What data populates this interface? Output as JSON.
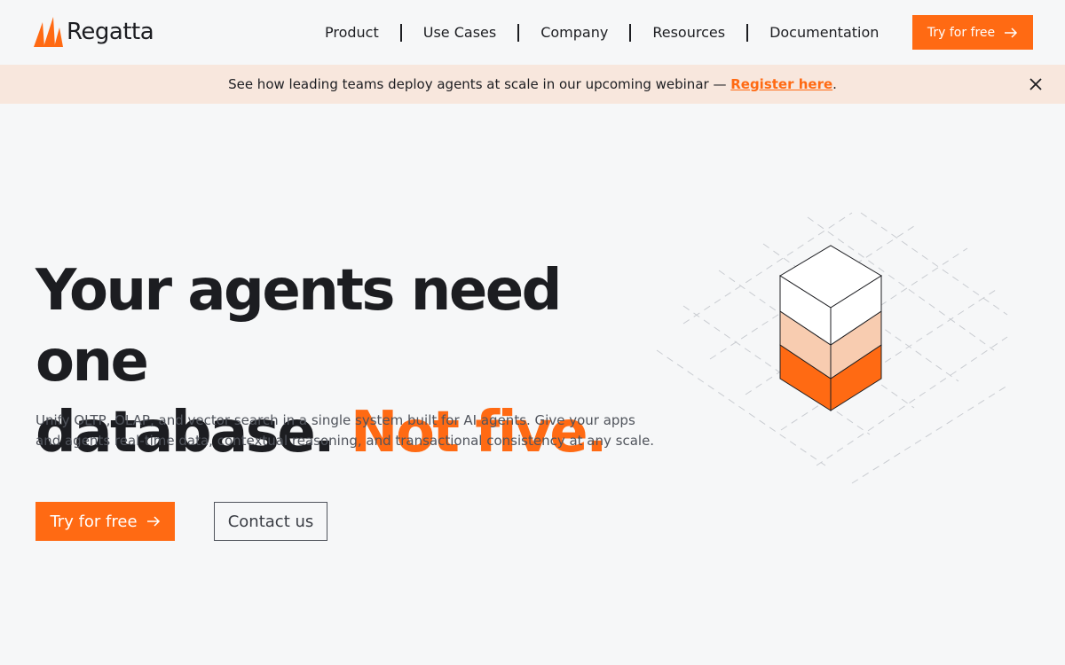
{
  "brand": {
    "name": "Regatta",
    "accent": "#ff6a13",
    "logo_icon": "sails-logo-icon"
  },
  "nav": {
    "items": [
      {
        "label": "Product"
      },
      {
        "label": "Use Cases"
      },
      {
        "label": "Company"
      },
      {
        "label": "Resources"
      },
      {
        "label": "Documentation"
      }
    ],
    "cta_label": "Try for free",
    "cta_icon": "arrow-right-icon"
  },
  "banner": {
    "text": "See how leading teams deploy agents at scale in our upcoming webinar — ",
    "link_label": "Register here",
    "suffix": ".",
    "close_icon": "close-icon",
    "background": "#f8e7dd"
  },
  "hero": {
    "title_line1": "Your agents need one",
    "title_line2": "database. ",
    "title_accent": "Not five.",
    "subtitle": "Unify OLTP, OLAP, and vector search in a single system built for AI agents. Give your apps and agents real-time data, contextual reasoning, and transactional consistency at any scale.",
    "primary_cta": "Try for free",
    "secondary_cta": "Contact us",
    "illustration_icon": "stacked-cube-icon"
  }
}
